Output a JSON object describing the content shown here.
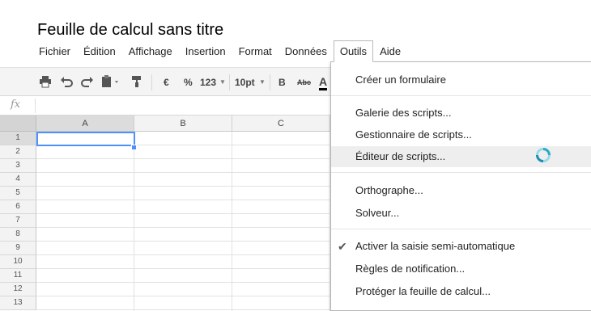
{
  "document": {
    "title": "Feuille de calcul sans titre"
  },
  "menubar": {
    "items": [
      "Fichier",
      "Édition",
      "Affichage",
      "Insertion",
      "Format",
      "Données",
      "Outils",
      "Aide"
    ],
    "open_menu": "Outils"
  },
  "toolbar": {
    "currency": "€",
    "percent": "%",
    "number_format": "123",
    "font_size": "10pt",
    "bold": "B",
    "strikethrough": "Abc",
    "text_color": "A"
  },
  "formula_bar": {
    "fx_label": "fx",
    "value": ""
  },
  "grid": {
    "columns": [
      "A",
      "B",
      "C"
    ],
    "rows": [
      "1",
      "2",
      "3",
      "4",
      "5",
      "6",
      "7",
      "8",
      "9",
      "10",
      "11",
      "12",
      "13"
    ],
    "selected_cell": "A1"
  },
  "tools_menu": {
    "items": [
      {
        "label": "Créer un formulaire"
      },
      {
        "label": "Galerie des scripts..."
      },
      {
        "label": "Gestionnaire de scripts..."
      },
      {
        "label": "Éditeur de scripts..."
      },
      {
        "label": "Orthographe..."
      },
      {
        "label": "Solveur..."
      },
      {
        "label": "Activer la saisie semi-automatique",
        "checked": true
      },
      {
        "label": "Règles de notification..."
      },
      {
        "label": "Protéger la feuille de calcul..."
      }
    ],
    "hovered_item": "Éditeur de scripts..."
  },
  "colors": {
    "selection_blue": "#4d90fe",
    "toolbar_bg": "#f4f4f4",
    "menu_hover": "#eeeeee",
    "spinner": "#2aa9c9"
  }
}
